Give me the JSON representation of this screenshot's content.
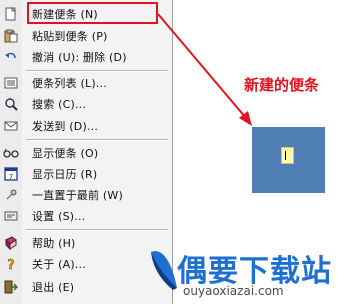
{
  "menu": {
    "items": [
      {
        "label": "新建便条 (N)",
        "icon": "new-note-icon"
      },
      {
        "label": "粘贴到便条 (P)",
        "icon": "paste-icon"
      },
      {
        "label": "撤消 (U): 删除 (D)",
        "icon": "undo-icon"
      },
      {
        "label": "便条列表 (L)...",
        "icon": "list-icon"
      },
      {
        "label": "搜索 (C)...",
        "icon": "search-icon"
      },
      {
        "label": "发送到 (D)...",
        "icon": "send-icon"
      },
      {
        "label": "显示便条 (O)",
        "icon": "glasses-icon"
      },
      {
        "label": "显示日历 (R)",
        "icon": "calendar-icon"
      },
      {
        "label": "一直置于最前 (W)",
        "icon": "pin-icon"
      },
      {
        "label": "设置 (S)...",
        "icon": "settings-icon"
      },
      {
        "label": "帮助 (H)",
        "icon": "help-book-icon"
      },
      {
        "label": "关于 (A)...",
        "icon": "about-icon"
      },
      {
        "label": "退出 (E)",
        "icon": "exit-icon"
      }
    ]
  },
  "annotation": {
    "text": "新建的便条",
    "color": "#e0141e"
  },
  "note_preview": {
    "background": "#4f7eb4",
    "paper": "#fdf7a6"
  },
  "logo": {
    "title": "偶要下载站",
    "url": "ouyaoxiazai.com",
    "color": "#1f6fd0"
  }
}
